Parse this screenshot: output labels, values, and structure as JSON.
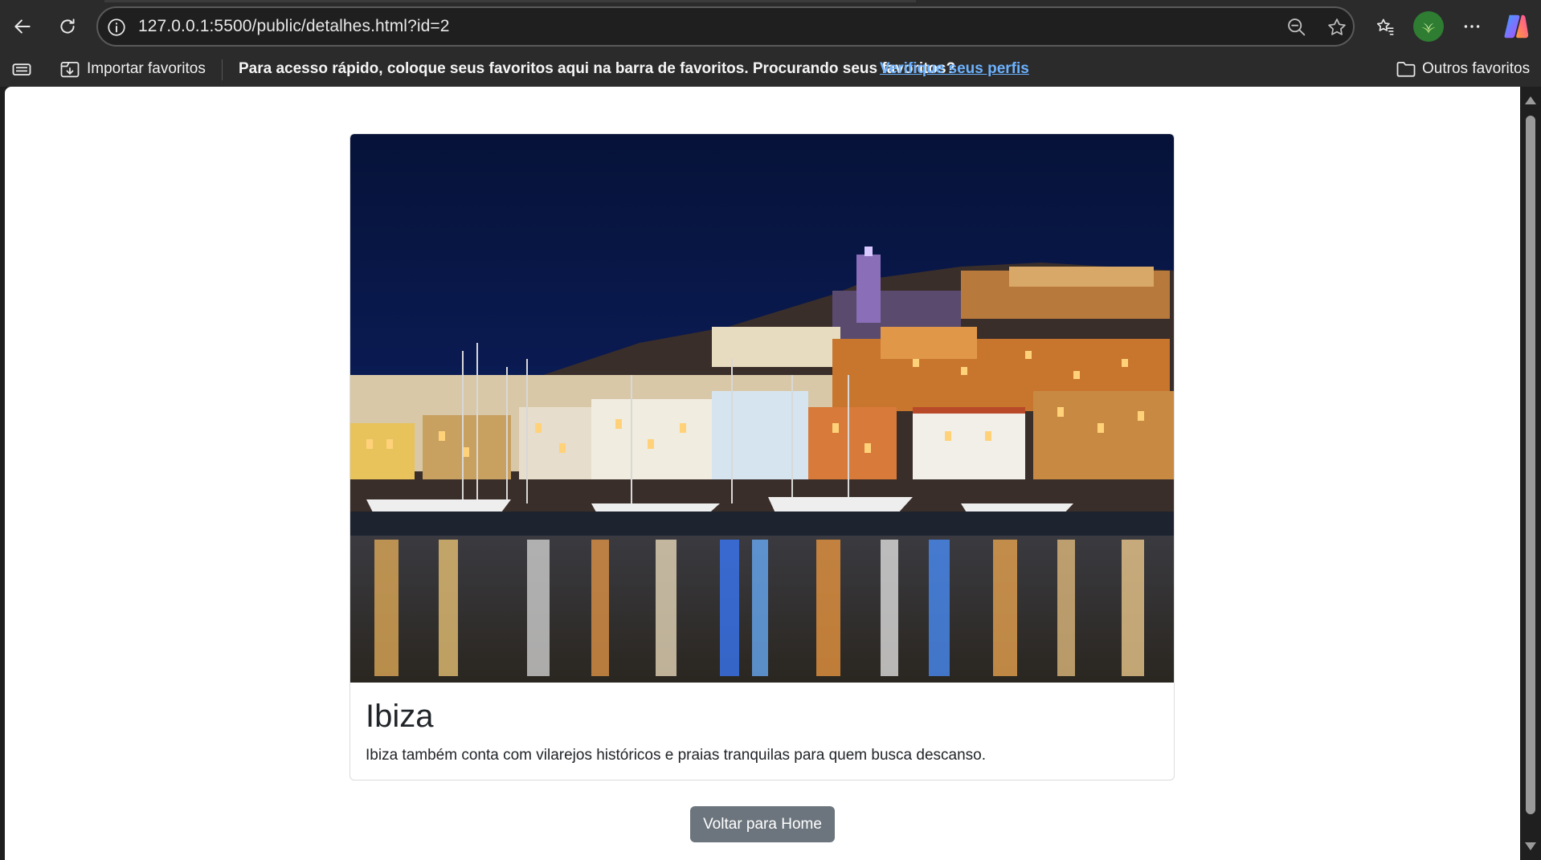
{
  "browser": {
    "url": "127.0.0.1:5500/public/detalhes.html?id=2",
    "favorites_bar": {
      "import_label": "Importar favoritos",
      "message": "Para acesso rápido, coloque seus favoritos aqui na barra de favoritos. Procurando seus favoritos?",
      "link_label": "Verifique seus perfis",
      "other_favorites_label": "Outros favoritos"
    },
    "icons": [
      "back-icon",
      "refresh-icon",
      "info-icon",
      "zoom-out-icon",
      "star-icon",
      "favorites-icon",
      "more-icon",
      "copilot-icon",
      "reading-view-icon",
      "import-icon",
      "folder-icon"
    ]
  },
  "page": {
    "card": {
      "image_alt": "Ibiza",
      "title": "Ibiza",
      "description": "Ibiza também conta com vilarejos históricos e praias tranquilas para quem busca descanso."
    },
    "home_button_label": "Voltar para Home",
    "colors": {
      "button_bg": "#6c757d",
      "link": "#6cb2ff"
    }
  }
}
